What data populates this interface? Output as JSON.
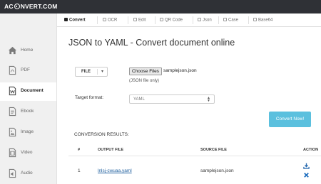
{
  "brand": {
    "logo_left": "AC",
    "logo_right": "NVERT.COM"
  },
  "tabs": [
    {
      "label": "Convert",
      "active": true
    },
    {
      "label": "OCR",
      "active": false
    },
    {
      "label": "Edit",
      "active": false
    },
    {
      "label": "QR Code",
      "active": false
    },
    {
      "label": "Json",
      "active": false
    },
    {
      "label": "Case",
      "active": false
    },
    {
      "label": "Base64",
      "active": false
    }
  ],
  "sidebar": {
    "items": [
      {
        "label": "Home",
        "icon": "home-icon",
        "active": false
      },
      {
        "label": "PDF",
        "icon": "pdf-icon",
        "active": false
      },
      {
        "label": "Document",
        "icon": "document-icon",
        "active": true
      },
      {
        "label": "Ebook",
        "icon": "ebook-icon",
        "active": false
      },
      {
        "label": "Image",
        "icon": "image-icon",
        "active": false
      },
      {
        "label": "Video",
        "icon": "video-icon",
        "active": false
      },
      {
        "label": "Audio",
        "icon": "audio-icon",
        "active": false
      }
    ]
  },
  "main": {
    "title": "JSON to YAML - Convert document online",
    "source_button": "FILE",
    "choose_files_label": "Choose Files",
    "chosen_file": "samplejson.json",
    "file_hint": "(JSON file only)",
    "target_format_label": "Target format:",
    "target_format_value": "YAML",
    "convert_button": "Convert Now!"
  },
  "results": {
    "title": "CONVERSION RESULTS:",
    "columns": [
      "#",
      "OUTPUT FILE",
      "SOURCE FILE",
      "ACTION"
    ],
    "rows": [
      {
        "index": "1",
        "output_file": "lnlsj-cwuaa.yaml",
        "source_file": "samplejson.json"
      }
    ]
  },
  "colors": {
    "topbar": "#2f3136",
    "accent": "#5bc0de",
    "link": "#1f5f9e",
    "download_icon": "#2b6cb0",
    "delete_icon": "#1f6fbf"
  }
}
